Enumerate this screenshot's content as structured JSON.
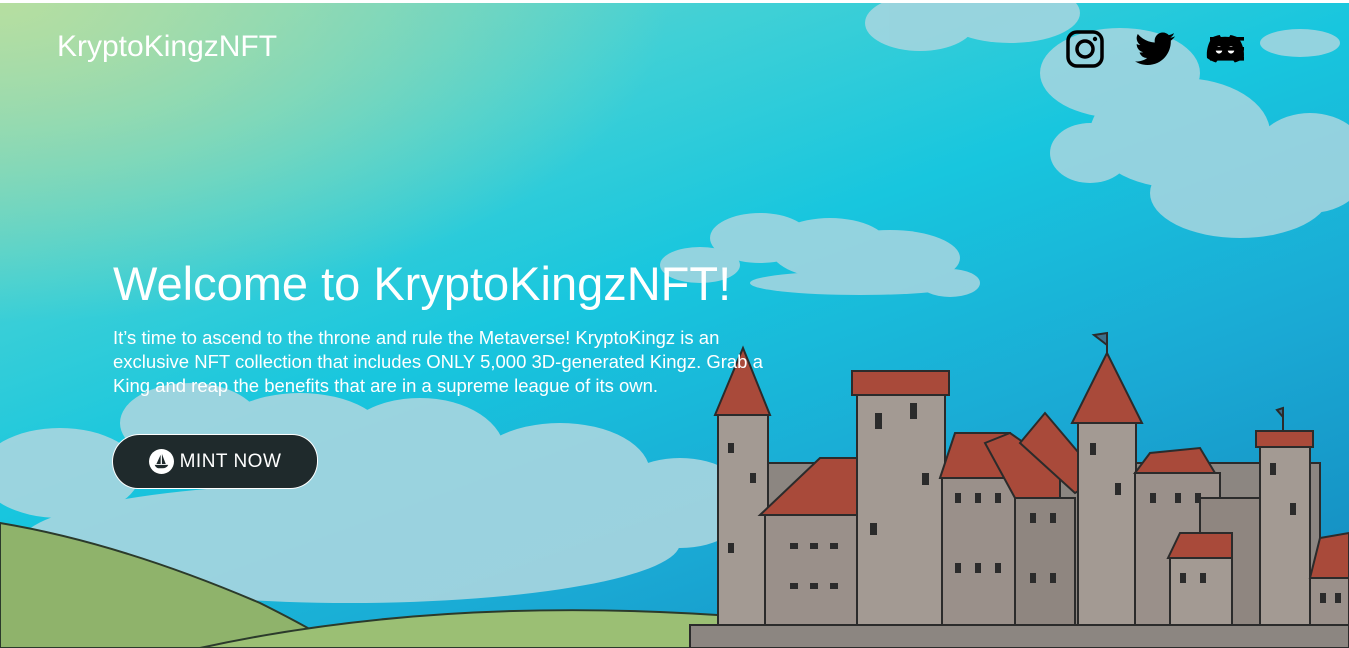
{
  "header": {
    "logo_text": "KryptoKingzNFT",
    "social_icons": [
      "instagram-icon",
      "twitter-icon",
      "discord-icon"
    ],
    "menu_icon": "hamburger-menu-icon"
  },
  "hero": {
    "headline": "Welcome to KryptoKingzNFT!",
    "description": "It’s time to ascend to the throne and rule the Metaverse! KryptoKingz is an exclusive NFT collection that includes ONLY 5,000 3D-generated Kingz. Grab a King and reap the benefits that are in a supreme league of its own.",
    "cta_label": "MINT NOW",
    "cta_icon": "opensea-icon"
  },
  "colors": {
    "sky_top": "#3fd0d6",
    "sky_bottom": "#1387bd",
    "text": "#ffffff",
    "button_bg": "#1f2a2c",
    "grass": "#8fb36b",
    "roof": "#a94a3a",
    "stone": "#9a8f88"
  }
}
